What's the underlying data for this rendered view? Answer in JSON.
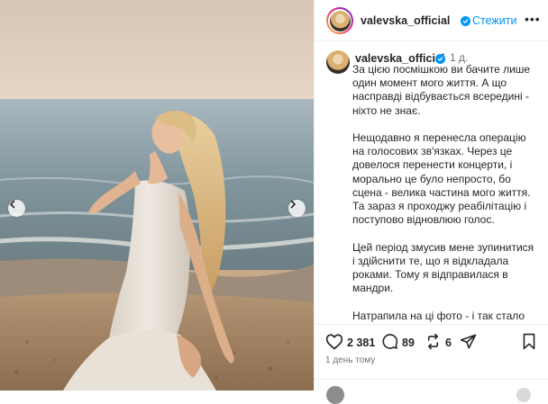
{
  "post": {
    "username": "valevska_official",
    "follow_label": "Стежити",
    "more_label": "•••",
    "caption_username": "valevska_official",
    "caption_time": "1 д.",
    "caption": "За цією посмішкою ви бачите лише один момент мого життя. А що насправді відбувається всередині - ніхто не знає.\n\nНещодавно я перенесла операцію на голосових зв'язках. Через це довелося перенести концерти, і морально це було непросто, бо сцена - велика частина мого життя. Та зараз я проходжу реабілітацію і поступово відновлюю голос.\n\nЦей період змусив мене зупинитися і здійснити те, що я відкладала роками. Тому я відправилася в мандри.\n\nНатрапила на ці фото - і так стало добре. Бо це моменти щастя, які майстерно створила Оксаночка на березі Золотих пісків 🤍",
    "likes": "2 381",
    "comments": "89",
    "reposts": "6",
    "time_ago": "1 день тому"
  },
  "icons": {
    "prev": "chevron-left-icon",
    "next": "chevron-right-icon",
    "like": "heart-icon",
    "comment": "comment-icon",
    "repost": "repost-icon",
    "share": "send-icon",
    "save": "bookmark-icon",
    "verified": "verified-badge-icon"
  },
  "colors": {
    "accent": "#0095f6",
    "text": "#262626",
    "muted": "#737373"
  }
}
